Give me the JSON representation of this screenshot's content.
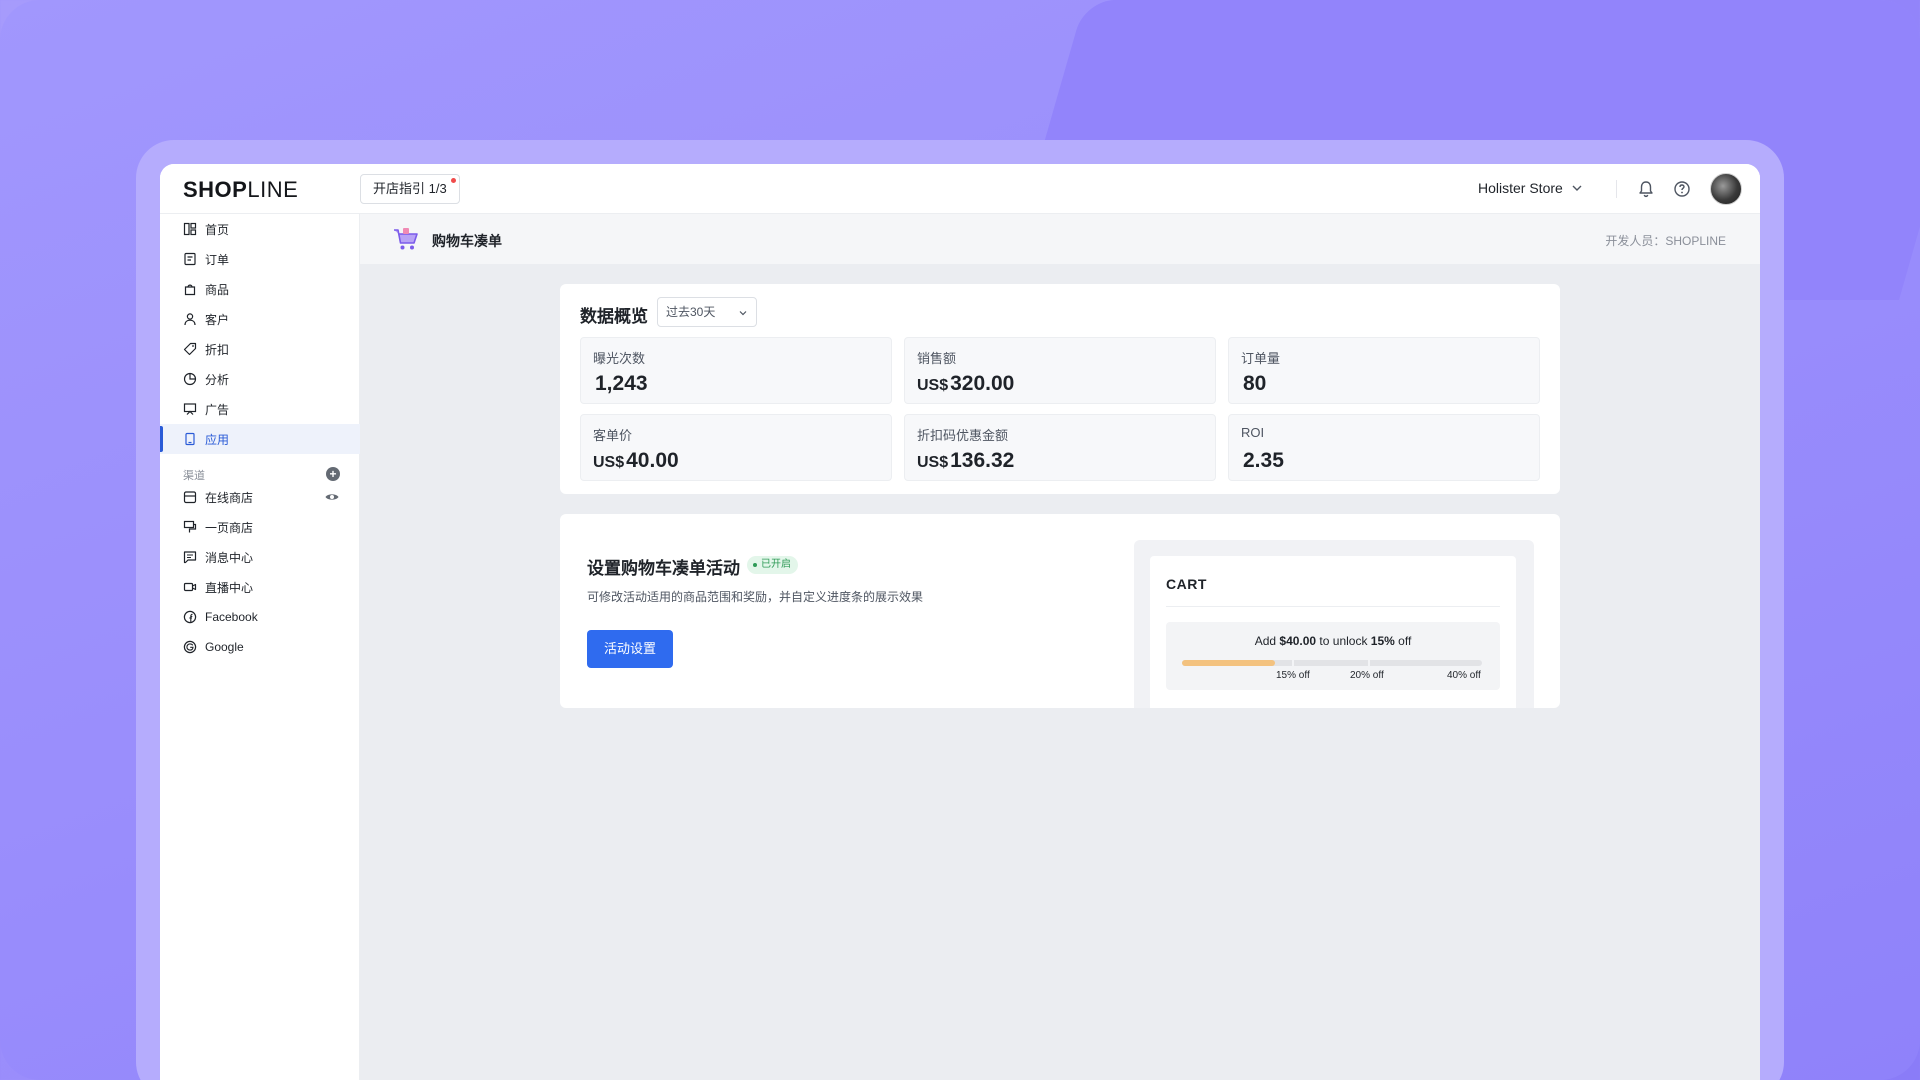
{
  "header": {
    "logo_bold": "SHOP",
    "logo_thin": "LINE",
    "guide_label": "开店指引 1/3",
    "store_name": "Holister Store"
  },
  "sidebar": {
    "items": [
      {
        "label": "首页",
        "icon": "home-icon"
      },
      {
        "label": "订单",
        "icon": "order-icon"
      },
      {
        "label": "商品",
        "icon": "product-icon"
      },
      {
        "label": "客户",
        "icon": "customer-icon"
      },
      {
        "label": "折扣",
        "icon": "tag-icon"
      },
      {
        "label": "分析",
        "icon": "chart-icon"
      },
      {
        "label": "广告",
        "icon": "ad-icon"
      },
      {
        "label": "应用",
        "icon": "app-icon"
      }
    ],
    "channels_label": "渠道",
    "channels": [
      {
        "label": "在线商店",
        "icon": "store-icon"
      },
      {
        "label": "一页商店",
        "icon": "one-page-icon"
      },
      {
        "label": "消息中心",
        "icon": "message-icon"
      },
      {
        "label": "直播中心",
        "icon": "live-icon"
      },
      {
        "label": "Facebook",
        "icon": "facebook-icon"
      },
      {
        "label": "Google",
        "icon": "google-icon"
      }
    ],
    "active_index": 7,
    "colors": {
      "active": "#2a5bd7"
    }
  },
  "page": {
    "title": "购物车凑单",
    "developer": "开发人员：SHOPLINE"
  },
  "overview": {
    "title": "数据概览",
    "range": "过去30天",
    "stats": [
      {
        "label": "曝光次数",
        "unit": "",
        "value": "1,243"
      },
      {
        "label": "销售额",
        "unit": "US$",
        "value": "320.00"
      },
      {
        "label": "订单量",
        "unit": "",
        "value": "80"
      },
      {
        "label": "客单价",
        "unit": "US$",
        "value": "40.00"
      },
      {
        "label": "折扣码优惠金额",
        "unit": "US$",
        "value": "136.32"
      },
      {
        "label": "ROI",
        "unit": "",
        "value": "2.35"
      }
    ]
  },
  "activity": {
    "title": "设置购物车凑单活动",
    "status": "已开启",
    "description": "可修改活动适用的商品范围和奖励，并自定义进度条的展示效果",
    "button": "活动设置",
    "colors": {
      "primary": "#2f6bef",
      "status": "#2f9b57"
    }
  },
  "preview": {
    "cart_title": "CART",
    "promo_prefix": "Add ",
    "promo_amount": "$40.00",
    "promo_mid": " to unlock ",
    "promo_pct": "15%",
    "promo_suffix": " off",
    "progress": 0.31,
    "milestones": [
      "15% off",
      "20% off",
      "40% off"
    ],
    "colors": {
      "progress": "#f3c27f"
    }
  }
}
